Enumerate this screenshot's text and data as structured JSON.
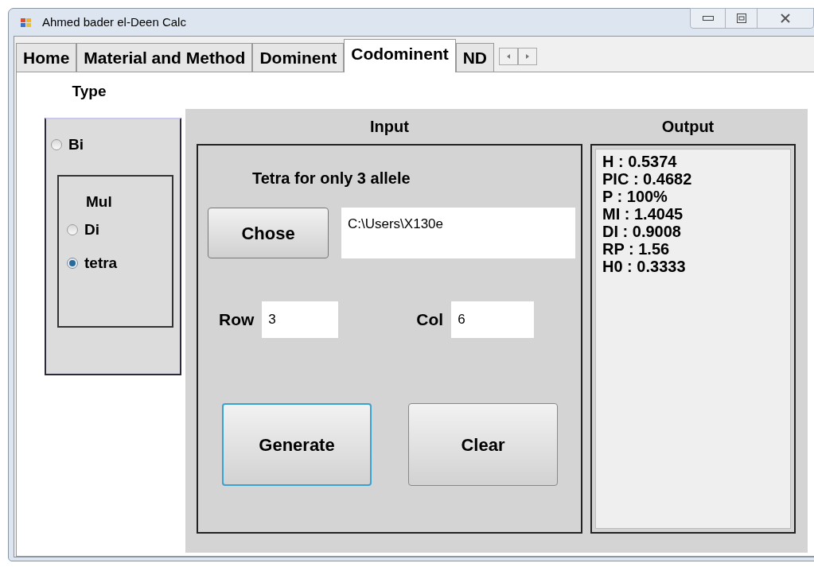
{
  "window": {
    "title": "Ahmed bader el-Deen Calc"
  },
  "tabs": [
    {
      "label": "Home",
      "selected": false
    },
    {
      "label": "Material and Method",
      "selected": false
    },
    {
      "label": "Dominent",
      "selected": false
    },
    {
      "label": "Codominent",
      "selected": true
    },
    {
      "label": "ND",
      "selected": false
    }
  ],
  "type_panel": {
    "title": "Type",
    "options": [
      {
        "label": "Bi",
        "selected": false
      }
    ],
    "group": {
      "title": "Mul",
      "options": [
        {
          "label": "Di",
          "selected": false
        },
        {
          "label": "tetra",
          "selected": true
        }
      ]
    }
  },
  "input_panel": {
    "title": "Input",
    "heading": "Tetra for only 3 allele",
    "chose_button": "Chose",
    "path_field": "C:\\Users\\X130e",
    "row": {
      "label": "Row",
      "value": "3"
    },
    "col": {
      "label": "Col",
      "value": "6"
    },
    "buttons": [
      {
        "label": "Generate",
        "focused": true
      },
      {
        "label": "Clear",
        "focused": false
      }
    ]
  },
  "output_panel": {
    "title": "Output",
    "lines": [
      "H : 0.5374",
      "PIC : 0.4682",
      "P : 100%",
      "MI : 1.4045",
      "DI : 0.9008",
      "RP : 1.56",
      "H0 : 0.3333"
    ]
  }
}
